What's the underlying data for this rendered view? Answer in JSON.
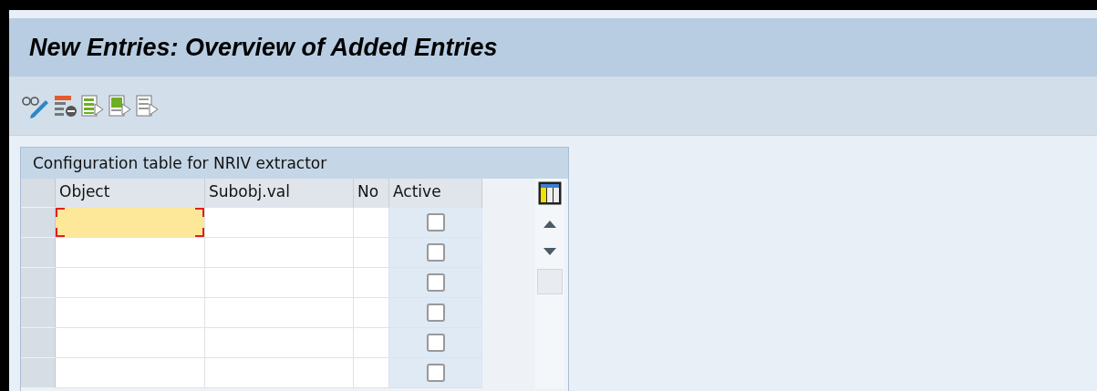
{
  "window": {
    "title": "New Entries: Overview of Added Entries"
  },
  "toolbar": [
    {
      "kind": "glasses-pencil"
    },
    {
      "kind": "delete-row"
    },
    {
      "kind": "select-all"
    },
    {
      "kind": "select-block"
    },
    {
      "kind": "deselect-all"
    }
  ],
  "table": {
    "title": "Configuration table for NRIV extractor",
    "columns": [
      "Object",
      "Subobj.val",
      "No",
      "Active"
    ],
    "rows": [
      {
        "focused": true,
        "active": false
      },
      {
        "focused": false,
        "active": false
      },
      {
        "focused": false,
        "active": false
      },
      {
        "focused": false,
        "active": false
      },
      {
        "focused": false,
        "active": false
      },
      {
        "focused": false,
        "active": false
      }
    ]
  }
}
